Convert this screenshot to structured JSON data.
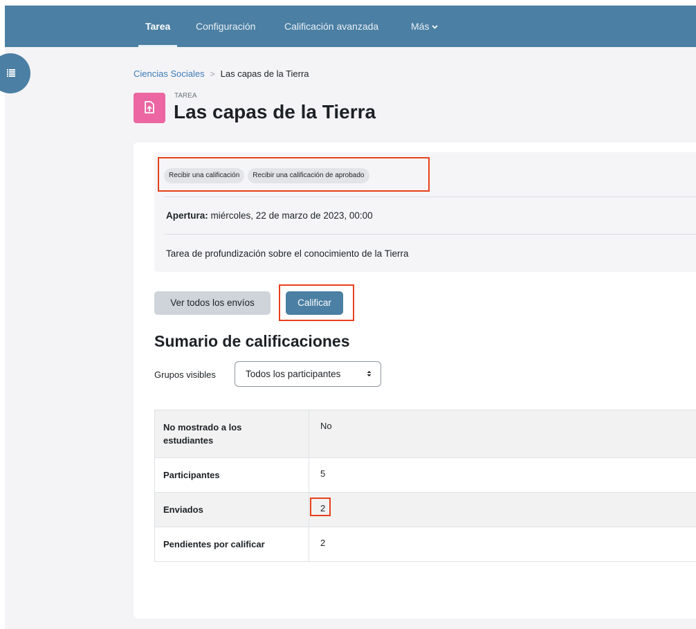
{
  "nav": {
    "tabs": [
      {
        "label": "Tarea",
        "active": true
      },
      {
        "label": "Configuración",
        "active": false
      },
      {
        "label": "Calificación avanzada",
        "active": false
      },
      {
        "label": "Más",
        "active": false
      }
    ],
    "icons": {
      "more": "chevron-down-icon",
      "drawer": "list-icon"
    }
  },
  "breadcrumb": {
    "parent": "Ciencias Sociales",
    "current": "Las capas de la Tierra"
  },
  "activity": {
    "type_label": "TAREA",
    "title": "Las capas de la Tierra",
    "icon": "assignment-upload-icon",
    "icon_color": "#eb66a2",
    "completion": [
      "Recibir una calificación",
      "Recibir una calificación de aprobado"
    ],
    "opening_label": "Apertura:",
    "opening_value": "miércoles, 22 de marzo de 2023, 00:00",
    "description": "Tarea de profundización sobre el conocimiento de la Tierra"
  },
  "actions": {
    "view_all": "Ver todos los envíos",
    "grade": "Calificar"
  },
  "summary": {
    "title": "Sumario de calificaciones",
    "groups_label": "Grupos visibles",
    "groups_value": "Todos los participantes",
    "rows": [
      {
        "label": "No mostrado a los estudiantes",
        "value": "No"
      },
      {
        "label": "Participantes",
        "value": "5"
      },
      {
        "label": "Enviados",
        "value": "2"
      },
      {
        "label": "Pendientes por calificar",
        "value": "2"
      }
    ]
  },
  "colors": {
    "nav_bg": "#4b7fa3",
    "primary": "#4b7fa3",
    "highlight": "#e8411b",
    "link": "#3d7ab8"
  }
}
